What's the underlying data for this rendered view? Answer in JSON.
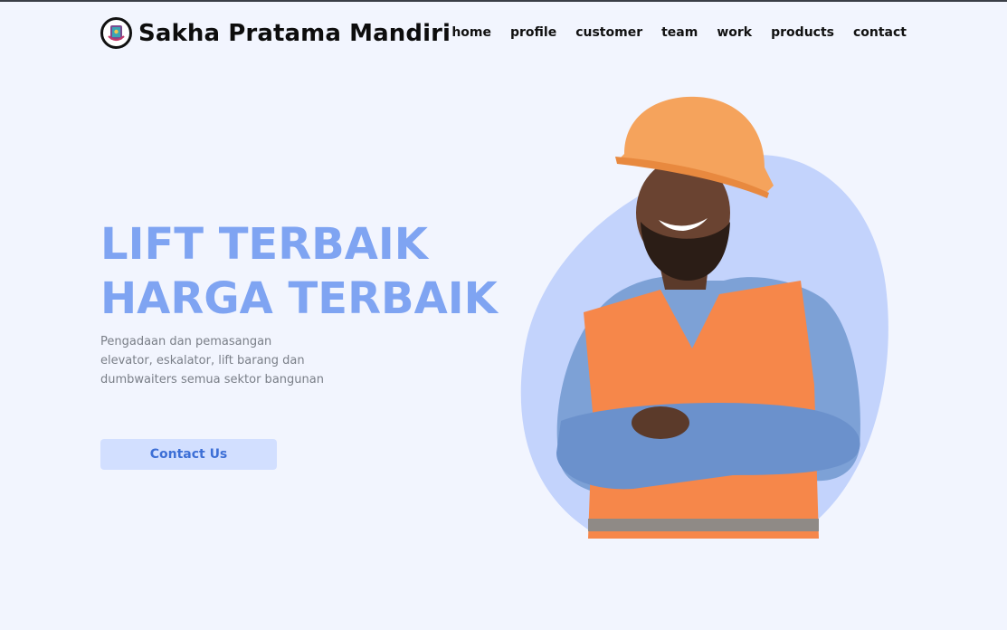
{
  "header": {
    "brand": "Sakha Pratama Mandiri",
    "logo_icon": "elevator-logo-icon"
  },
  "nav": {
    "items": [
      "home",
      "profile",
      "customer",
      "team",
      "work",
      "products",
      "contact"
    ]
  },
  "hero": {
    "title_line1": "LIFT TERBAIK",
    "title_line2": "HARGA TERBAIK",
    "subtitle": "Pengadaan dan pemasangan elevator, eskalator, lift barang dan dumbwaiters semua sektor bangunan",
    "cta_label": "Contact Us"
  },
  "colors": {
    "background": "#f2f5fe",
    "accent": "#7fa4f2",
    "button_bg": "#d2dfff",
    "button_text": "#3d6fd6",
    "blob": "#c3d3fc",
    "vest": "#f6874a",
    "helmet": "#f5a35c",
    "shirt": "#7da1d6"
  }
}
